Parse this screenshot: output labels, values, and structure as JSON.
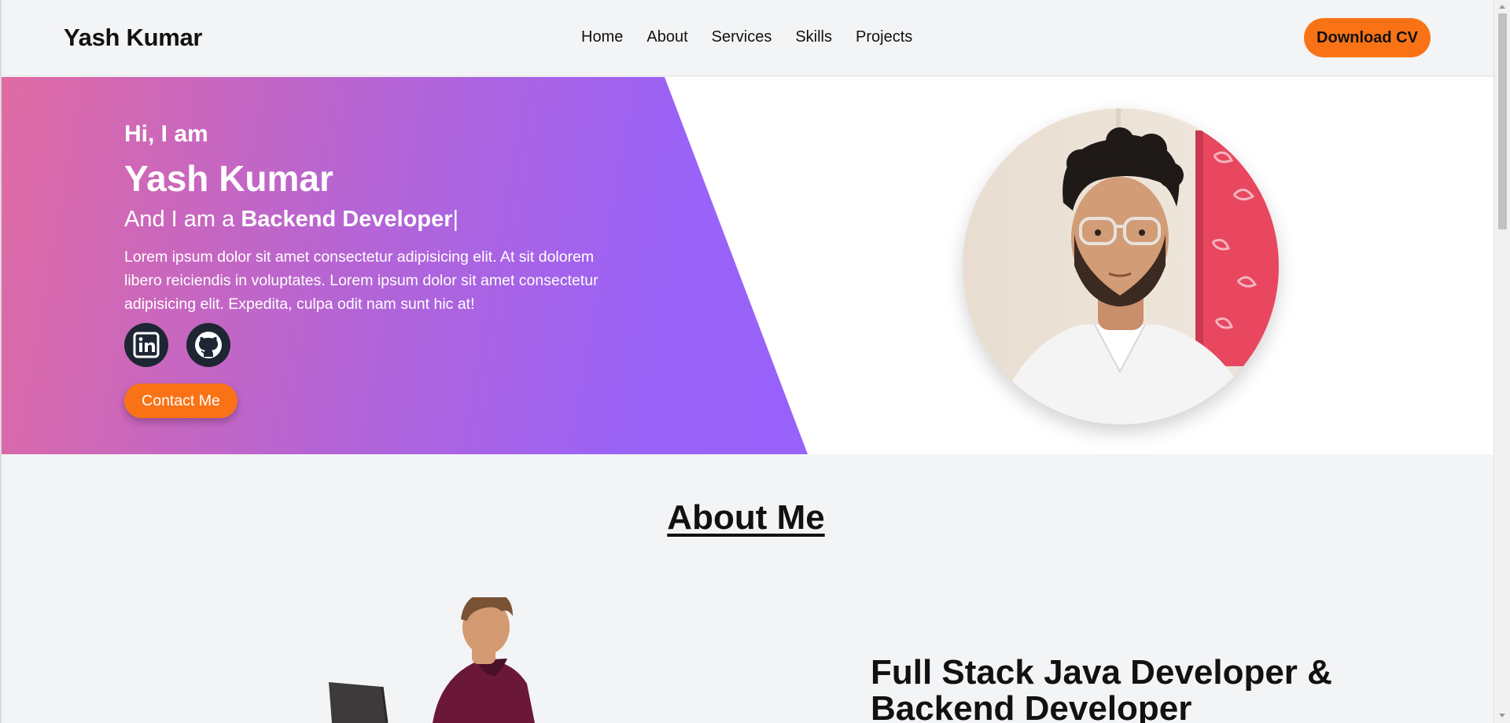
{
  "header": {
    "brand": "Yash Kumar",
    "nav": [
      "Home",
      "About",
      "Services",
      "Skills",
      "Projects"
    ],
    "cta_label": "Download CV"
  },
  "hero": {
    "greeting": "Hi, I am",
    "name": "Yash Kumar",
    "role_prefix": "And I am a",
    "role": "Backend Developer",
    "caret": "|",
    "description": "Lorem ipsum dolor sit amet consectetur adipisicing elit. At sit dolorem libero reiciendis in voluptates. Lorem ipsum dolor sit amet consectetur adipisicing elit. Expedita, culpa odit nam sunt hic at!",
    "social_icons": [
      "linkedin-icon",
      "github-icon"
    ],
    "contact_label": "Contact Me",
    "colors": {
      "gradient_start": "#e06aa3",
      "gradient_end": "#9862fb",
      "accent": "#f97316",
      "social_bg": "#1e2533"
    }
  },
  "about": {
    "title": "About Me",
    "subtitle": "Full Stack Java Developer & Backend Developer"
  }
}
